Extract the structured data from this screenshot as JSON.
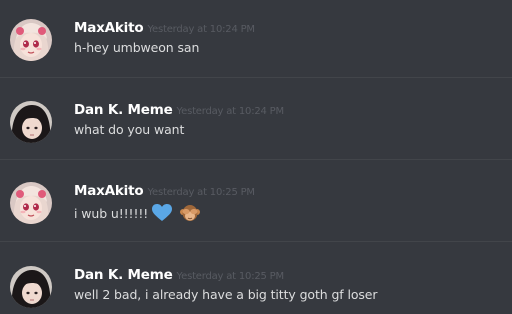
{
  "messages": [
    {
      "username": "MaxAkito",
      "timestamp": "Yesterday at 10:24 PM",
      "text": "h-hey umbweon san",
      "avatar": "anime-girl-avatar"
    },
    {
      "username": "Dan K. Meme",
      "timestamp": "Yesterday at 10:24 PM",
      "text": "what do you want",
      "avatar": "dark-hair-avatar"
    },
    {
      "username": "MaxAkito",
      "timestamp": "Yesterday at 10:25 PM",
      "text": "i wub u!!!!!!",
      "avatar": "anime-girl-avatar",
      "emojis": [
        "blue-heart-emoji",
        "see-no-evil-monkey-emoji"
      ]
    },
    {
      "username": "Dan K. Meme",
      "timestamp": "Yesterday at 10:25 PM",
      "text": "well 2 bad, i already have a big titty goth gf loser",
      "avatar": "dark-hair-avatar"
    }
  ],
  "colors": {
    "background": "#36393f",
    "username": "#ffffff",
    "timestamp": "#585b62",
    "message_text": "#dcddde",
    "divider": "#42454a",
    "blue_heart": "#5aa7e6"
  }
}
